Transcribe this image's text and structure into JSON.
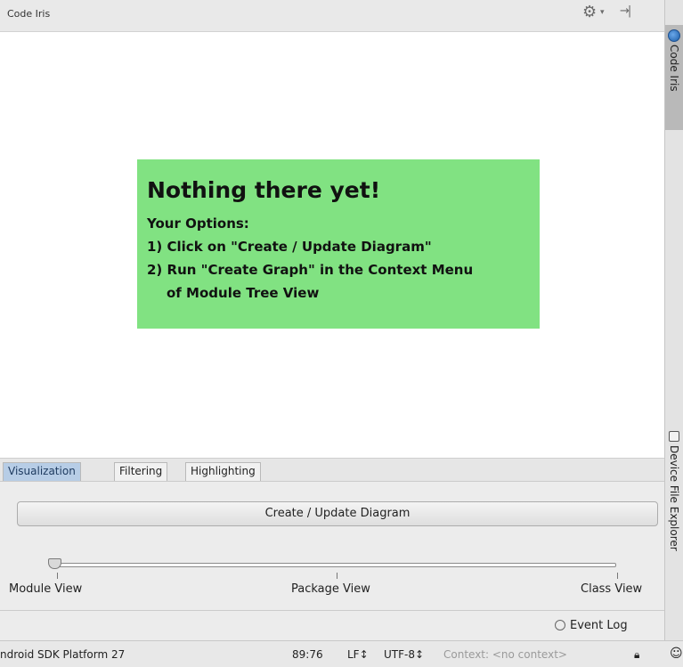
{
  "tool_window": {
    "title": "Code Iris",
    "settings_icon": "gear-icon",
    "hide_icon": "hide-panel-icon"
  },
  "placeholder": {
    "heading": "Nothing there yet!",
    "options_label": "Your Options:",
    "option_1": "1) Click on \"Create / Update Diagram\"",
    "option_2_line1": "2) Run \"Create Graph\" in the Context Menu",
    "option_2_line2": "of Module Tree View",
    "background": "#81e282"
  },
  "tabs": [
    {
      "label": "Visualization",
      "active": true
    },
    {
      "label": "Filtering",
      "active": false
    },
    {
      "label": "Highlighting",
      "active": false
    }
  ],
  "controls": {
    "create_button": "Create / Update Diagram",
    "slider": {
      "labels": [
        "Module View",
        "Package View",
        "Class View"
      ],
      "selected": "Module View",
      "value_fraction": 0.0
    }
  },
  "event_log": {
    "label": "Event Log",
    "icon": "event-log-icon"
  },
  "status_bar": {
    "sdk": "ndroid SDK Platform 27",
    "position": "89:76",
    "line_separator": "LF↕",
    "encoding": "UTF-8↕",
    "context": "Context: <no context>",
    "lock_icon": "lock-icon",
    "inspector_icon": "hector-icon"
  },
  "right_stripe": {
    "code_iris": "Code Iris",
    "device_file_explorer": "Device File Explorer"
  },
  "colors": {
    "active_tab": "#b7cde6",
    "canvas_background": "#ffffff"
  }
}
